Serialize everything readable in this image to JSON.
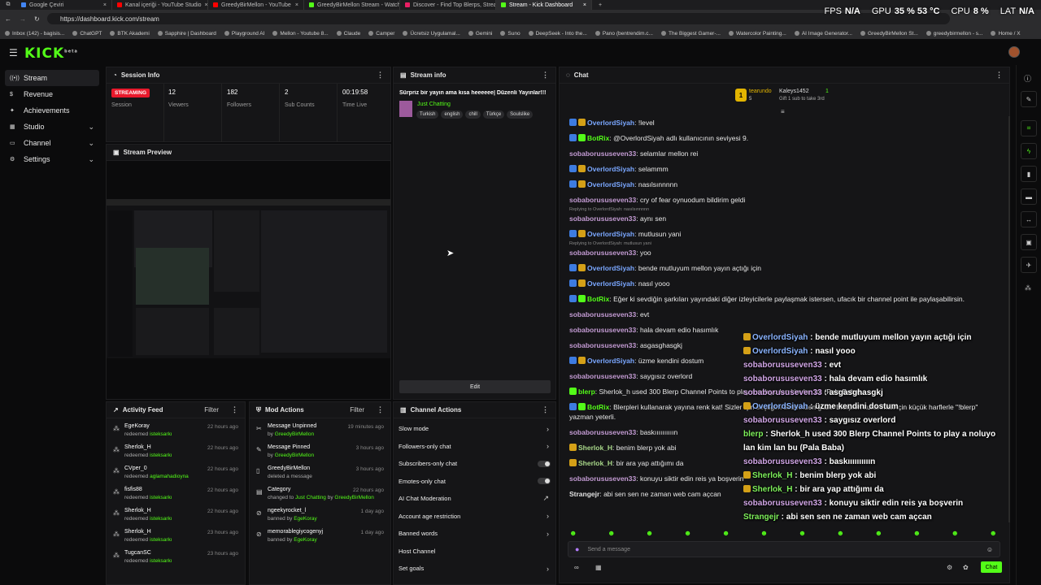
{
  "browser": {
    "tabs": [
      {
        "label": "Google Çeviri",
        "color": "#4285f4"
      },
      {
        "label": "Kanal içeriği - YouTube Studio",
        "color": "#ff0000"
      },
      {
        "label": "GreedyBirMellon - YouTube",
        "color": "#ff0000"
      },
      {
        "label": "GreedyBirMellon Stream - Watch",
        "color": "#53fc18"
      },
      {
        "label": "Discover - Find Top Blerps, Stream",
        "color": "#e91e63"
      },
      {
        "label": "Stream - Kick Dashboard",
        "color": "#53fc18"
      }
    ],
    "url": "https://dashboard.kick.com/stream",
    "bookmarks": [
      "Inbox (142) - bagisis...",
      "ChatGPT",
      "BTK Akademi",
      "Sapphire | Dashboard",
      "Playground AI",
      "Mellon - Youtube 8...",
      "Claude",
      "Camper",
      "Ücretsiz Uygulamal...",
      "Gemini",
      "Suno",
      "DeepSeek - Into the...",
      "Pano (bentrendim.c...",
      "The Biggest Gamer-...",
      "Watercolor Painting...",
      "AI Image Generator...",
      "GreedyBirMellon St...",
      "greedybirmellon - s...",
      "Home / X"
    ]
  },
  "overlay": {
    "fps_label": "FPS",
    "fps": "N/A",
    "gpu_label": "GPU",
    "gpu": "35 % 53 °C",
    "cpu_label": "CPU",
    "cpu": "8 %",
    "lat_label": "LAT",
    "lat": "N/A"
  },
  "logo": "KICK",
  "logo_sup": "beta",
  "sidebar": {
    "items": [
      {
        "label": "Stream",
        "icon": "stream-icon"
      },
      {
        "label": "Revenue",
        "icon": "revenue-icon"
      },
      {
        "label": "Achievements",
        "icon": "trophy-icon"
      },
      {
        "label": "Studio",
        "icon": "studio-icon"
      },
      {
        "label": "Channel",
        "icon": "channel-icon"
      },
      {
        "label": "Settings",
        "icon": "gear-icon"
      }
    ]
  },
  "session": {
    "title": "Session Info",
    "status": "STREAMING",
    "status_label": "Session",
    "viewers": "12",
    "viewers_label": "Viewers",
    "followers": "182",
    "followers_label": "Followers",
    "subs": "2",
    "subs_label": "Sub Counts",
    "time": "00:19:58",
    "time_label": "Time Live"
  },
  "preview": {
    "title": "Stream Preview"
  },
  "streaminfo": {
    "title": "Stream info",
    "stream_title": "Sürpriz bir yayın ama kısa heeeeee| Düzenli Yayınlar!!!",
    "category": "Just Chatting",
    "tags": [
      "Turkish",
      "english",
      "chill",
      "Türkçe",
      "Soulslike"
    ],
    "edit": "Edit"
  },
  "activity": {
    "title": "Activity Feed",
    "filter": "Filter",
    "rows": [
      {
        "name": "EgeKoray",
        "verb": "redeemed",
        "item": "isteksarkı",
        "time": "22 hours ago"
      },
      {
        "name": "Sherlok_H",
        "verb": "redeemed",
        "item": "isteksarkı",
        "time": "22 hours ago"
      },
      {
        "name": "CVper_0",
        "verb": "redeemed",
        "item": "aglamahadioyna",
        "time": "22 hours ago"
      },
      {
        "name": "fisfis88",
        "verb": "redeemed",
        "item": "isteksarkı",
        "time": "22 hours ago"
      },
      {
        "name": "Sherlok_H",
        "verb": "redeemed",
        "item": "isteksarkı",
        "time": "22 hours ago"
      },
      {
        "name": "Sherlok_H",
        "verb": "redeemed",
        "item": "isteksarkı",
        "time": "23 hours ago"
      },
      {
        "name": "TugcanSC",
        "verb": "redeemed",
        "item": "isteksarkı",
        "time": "23 hours ago"
      }
    ]
  },
  "modactions": {
    "title": "Mod Actions",
    "filter": "Filter",
    "rows": [
      {
        "name": "Message Unpinned",
        "verb": "by",
        "item": "GreedyBirMellon",
        "time": "19 minutes ago",
        "icon": "unpin-icon"
      },
      {
        "name": "Message Pinned",
        "verb": "by",
        "item": "GreedyBirMellon",
        "time": "3 hours ago",
        "icon": "pin-icon"
      },
      {
        "name": "GreedyBirMellon",
        "verb": "deleted a message",
        "item": "",
        "time": "3 hours ago",
        "icon": "trash-icon"
      },
      {
        "name": "Category",
        "verb": "changed to",
        "item": "Just Chatting",
        "by": "by",
        "byname": "GreedyBirMellon",
        "time": "22 hours ago",
        "icon": "category-icon"
      },
      {
        "name": "ngeekyrocket_l",
        "verb": "banned by",
        "item": "EgeKoray",
        "time": "1 day ago",
        "icon": "ban-icon"
      },
      {
        "name": "memorablegiycogenyj",
        "verb": "banned by",
        "item": "EgeKoray",
        "time": "1 day ago",
        "icon": "ban-icon"
      }
    ]
  },
  "channelactions": {
    "title": "Channel Actions",
    "items": [
      {
        "label": "Slow mode",
        "kind": "arrow"
      },
      {
        "label": "Followers-only chat",
        "kind": "arrow"
      },
      {
        "label": "Subscribers-only chat",
        "kind": "toggle"
      },
      {
        "label": "Emotes-only chat",
        "kind": "toggle"
      },
      {
        "label": "AI Chat Moderation",
        "kind": "ext"
      },
      {
        "label": "Account age restriction",
        "kind": "arrow"
      },
      {
        "label": "Banned words",
        "kind": "arrow"
      },
      {
        "label": "Host Channel",
        "kind": "none"
      },
      {
        "label": "Set goals",
        "kind": "arrow"
      }
    ]
  },
  "chat": {
    "title": "Chat",
    "gifter1": "tearundo",
    "gifter1_count": "5",
    "gifter2": "Kaleys1452",
    "gifter2_count": "1",
    "gift_cta": "Gift 1 sub to take 3rd",
    "input_placeholder": "Send a message",
    "send": "Chat",
    "messages": [
      {
        "user": "OverlordSiyah",
        "cls": "u1",
        "badges": [
          "#3d7be0",
          "#d4a017"
        ],
        "text": "!level"
      },
      {
        "user": "BotRix",
        "cls": "u3",
        "badges": [
          "#3d7be0",
          "#53fc18"
        ],
        "text": "@OverlordSiyah adlı kullanıcının seviyesi 9."
      },
      {
        "user": "sobaborususeven33",
        "cls": "u2",
        "badges": [],
        "text": "selamlar mellon rei"
      },
      {
        "user": "OverlordSiyah",
        "cls": "u1",
        "badges": [
          "#3d7be0",
          "#d4a017"
        ],
        "text": "selammm"
      },
      {
        "user": "OverlordSiyah",
        "cls": "u1",
        "badges": [
          "#3d7be0",
          "#d4a017"
        ],
        "text": "nasılsınnnnn"
      },
      {
        "user": "sobaborususeven33",
        "cls": "u2",
        "badges": [],
        "text": "cry of fear oynuodum bildirim geldi"
      },
      {
        "reply": "Replying to OverlordSiyah: nasılsınnnnn",
        "user": "sobaborususeven33",
        "cls": "u2",
        "badges": [],
        "text": "aynı sen"
      },
      {
        "user": "OverlordSiyah",
        "cls": "u1",
        "badges": [
          "#3d7be0",
          "#d4a017"
        ],
        "text": "mutlusun yani"
      },
      {
        "reply": "Replying to OverlordSiyah: mutlusun yani",
        "user": "sobaborususeven33",
        "cls": "u2",
        "badges": [],
        "text": "yoo"
      },
      {
        "user": "OverlordSiyah",
        "cls": "u1",
        "badges": [
          "#3d7be0",
          "#d4a017"
        ],
        "text": "bende mutluyum mellon yayın açtığı için"
      },
      {
        "user": "OverlordSiyah",
        "cls": "u1",
        "badges": [
          "#3d7be0",
          "#d4a017"
        ],
        "text": "nasıl yooo"
      },
      {
        "user": "BotRix",
        "cls": "u3",
        "badges": [
          "#3d7be0",
          "#53fc18"
        ],
        "text": "Eğer ki sevdiğin şarkıları yayındaki diğer izleyicilerle paylaşmak istersen, ufacık bir channel point ile paylaşabilirsin."
      },
      {
        "user": "sobaborususeven33",
        "cls": "u2",
        "badges": [],
        "text": "evt"
      },
      {
        "user": "sobaborususeven33",
        "cls": "u2",
        "badges": [],
        "text": "hala devam edio hasımlık"
      },
      {
        "user": "sobaborususeven33",
        "cls": "u2",
        "badges": [],
        "text": "asgasghasgkj"
      },
      {
        "user": "OverlordSiyah",
        "cls": "u1",
        "badges": [
          "#3d7be0",
          "#d4a017"
        ],
        "text": "üzme kendini dostum"
      },
      {
        "user": "sobaborususeven33",
        "cls": "u2",
        "badges": [],
        "text": "saygısız overlord"
      },
      {
        "user": "blerp",
        "cls": "u3",
        "badges": [
          "#53fc18"
        ],
        "text": "Sherlok_h used 300 Blerp Channel Points to play a noluyo lan kim lan bu (Pala Baba)"
      },
      {
        "user": "BotRix",
        "cls": "u3",
        "badges": [
          "#3d7be0",
          "#53fc18"
        ],
        "text": "Blerpleri kullanarak yayına renk kat! Sizler için seçtiğim birbirinden güzel Blerpleri kullanmak için küçük harflerle \"!blerp\" yazman yeterli."
      },
      {
        "user": "sobaborususeven33",
        "cls": "u2",
        "badges": [],
        "text": "baskıııııııııın"
      },
      {
        "user": "Sherlok_H",
        "cls": "u4",
        "badges": [
          "#d4a017"
        ],
        "text": "benim blerp yok abi"
      },
      {
        "user": "Sherlok_H",
        "cls": "u4",
        "badges": [
          "#d4a017"
        ],
        "text": "bir ara yap attığımı da"
      },
      {
        "user": "sobaborususeven33",
        "cls": "u2",
        "badges": [],
        "text": "konuyu siktir edin reis ya boşverin"
      },
      {
        "user": "Strangejr",
        "cls": "u5",
        "badges": [],
        "text": "abi sen sen ne zaman web cam açcan"
      }
    ]
  },
  "overlay_chat": [
    {
      "user": "OverlordSiyah",
      "cls": "c1",
      "text": "bende mutluyum mellon yayın açtığı için",
      "badges": true
    },
    {
      "user": "OverlordSiyah",
      "cls": "c1",
      "text": "nasıl yooo",
      "badges": true
    },
    {
      "user": "sobaborususeven33",
      "cls": "c2",
      "text": "evt"
    },
    {
      "user": "sobaborususeven33",
      "cls": "c2",
      "text": "hala devam edio hasımlık"
    },
    {
      "user": "sobaborususeven33",
      "cls": "c2",
      "text": "asgasghasgkj"
    },
    {
      "user": "OverlordSiyah",
      "cls": "c1",
      "text": "üzme kendini dostum",
      "badges": true
    },
    {
      "user": "sobaborususeven33",
      "cls": "c2",
      "text": "saygısız overlord"
    },
    {
      "user": "blerp",
      "cls": "c3",
      "text": "Sherlok_h used 300 Blerp Channel Points to play a noluyo"
    },
    {
      "user": "",
      "cls": "c3",
      "text": "lan kim lan bu (Pala Baba)"
    },
    {
      "user": "sobaborususeven33",
      "cls": "c2",
      "text": "baskıııııııııın"
    },
    {
      "user": "Sherlok_H",
      "cls": "c3",
      "text": "benim blerp yok abi",
      "badges": true
    },
    {
      "user": "Sherlok_H",
      "cls": "c3",
      "text": "bir ara yap attığımı da",
      "badges": true
    },
    {
      "user": "sobaborususeven33",
      "cls": "c2",
      "text": "konuyu siktir edin reis ya boşverin"
    },
    {
      "user": "Strangejr",
      "cls": "c3",
      "text": "abi sen sen ne zaman web cam açcan"
    }
  ]
}
